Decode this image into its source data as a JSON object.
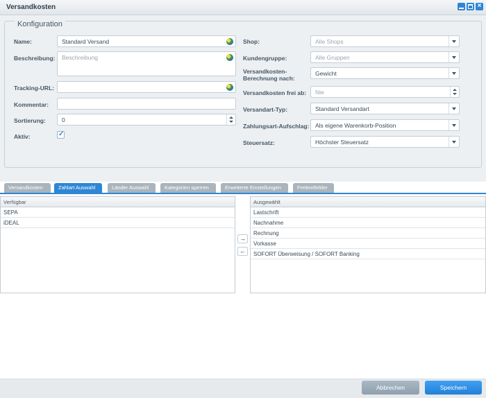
{
  "window": {
    "title": "Versandkosten",
    "accent": "#2e86d4"
  },
  "config": {
    "legend": "Konfiguration",
    "name_label": "Name:",
    "name_value": "Standard Versand",
    "description_label": "Beschreibung:",
    "description_placeholder": "Beschreibung",
    "tracking_label": "Tracking-URL:",
    "tracking_value": "",
    "comment_label": "Kommentar:",
    "comment_value": "",
    "sort_label": "Sortierung:",
    "sort_value": "0",
    "active_label": "Aktiv:",
    "active_checked": true,
    "shop_label": "Shop:",
    "shop_value": "Alle Shops",
    "customergroup_label": "Kundengruppe:",
    "customergroup_value": "Alle Gruppen",
    "calc_label_line1": "Versandkosten-",
    "calc_label_line2": "Berechnung nach:",
    "calc_value": "Gewicht",
    "free_label": "Versandkosten frei ab:",
    "free_placeholder": "Nie",
    "type_label": "Versandart-Typ:",
    "type_value": "Standard Versandart",
    "surcharge_label": "Zahlungsart-Aufschlag:",
    "surcharge_value": "Als eigene Warenkorb-Position",
    "tax_label": "Steuersatz:",
    "tax_value": "Höchster Steuersatz"
  },
  "tabs": [
    {
      "label": "Versandkosten",
      "active": false
    },
    {
      "label": "Zahlart Auswahl",
      "active": true
    },
    {
      "label": "Länder Auswahl",
      "active": false
    },
    {
      "label": "Kategorien sperren",
      "active": false
    },
    {
      "label": "Erweiterte Einstellungen",
      "active": false
    },
    {
      "label": "Freitextfelder",
      "active": false
    }
  ],
  "available": {
    "header": "Verfügbar",
    "items": [
      "SEPA",
      "iDEAL"
    ]
  },
  "selected": {
    "header": "Ausgewählt",
    "items": [
      "Lastschrift",
      "Nachnahme",
      "Rechnung",
      "Vorkasse",
      "SOFORT Überweisung / SOFORT Banking"
    ]
  },
  "arrows": {
    "add": "→",
    "remove": "←"
  },
  "footer": {
    "cancel_label": "Abbrechen",
    "save_label": "Speichern"
  }
}
